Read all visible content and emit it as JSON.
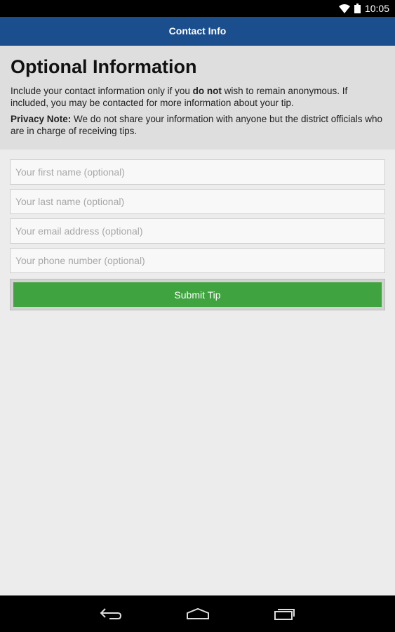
{
  "status_bar": {
    "time": "10:05"
  },
  "app_bar": {
    "title": "Contact Info"
  },
  "info": {
    "title": "Optional Information",
    "intro_before": "Include your contact information only if you ",
    "intro_bold": "do not",
    "intro_after": " wish to remain anonymous. If included, you may be contacted for more information about your tip.",
    "privacy_label": "Privacy Note:",
    "privacy_text": " We do not share your information with anyone but the district officials who are in charge of receiving tips."
  },
  "form": {
    "first_name_placeholder": "Your first name (optional)",
    "last_name_placeholder": "Your last name (optional)",
    "email_placeholder": "Your email address (optional)",
    "phone_placeholder": "Your phone number (optional)",
    "submit_label": "Submit Tip"
  },
  "icons": {
    "wifi": "wifi-icon",
    "battery": "battery-icon",
    "back": "back-icon",
    "home": "home-icon",
    "recents": "recents-icon"
  },
  "colors": {
    "app_bar": "#1b4e8c",
    "submit_button": "#3fa33f",
    "info_panel": "#dedede",
    "background": "#ececec"
  }
}
